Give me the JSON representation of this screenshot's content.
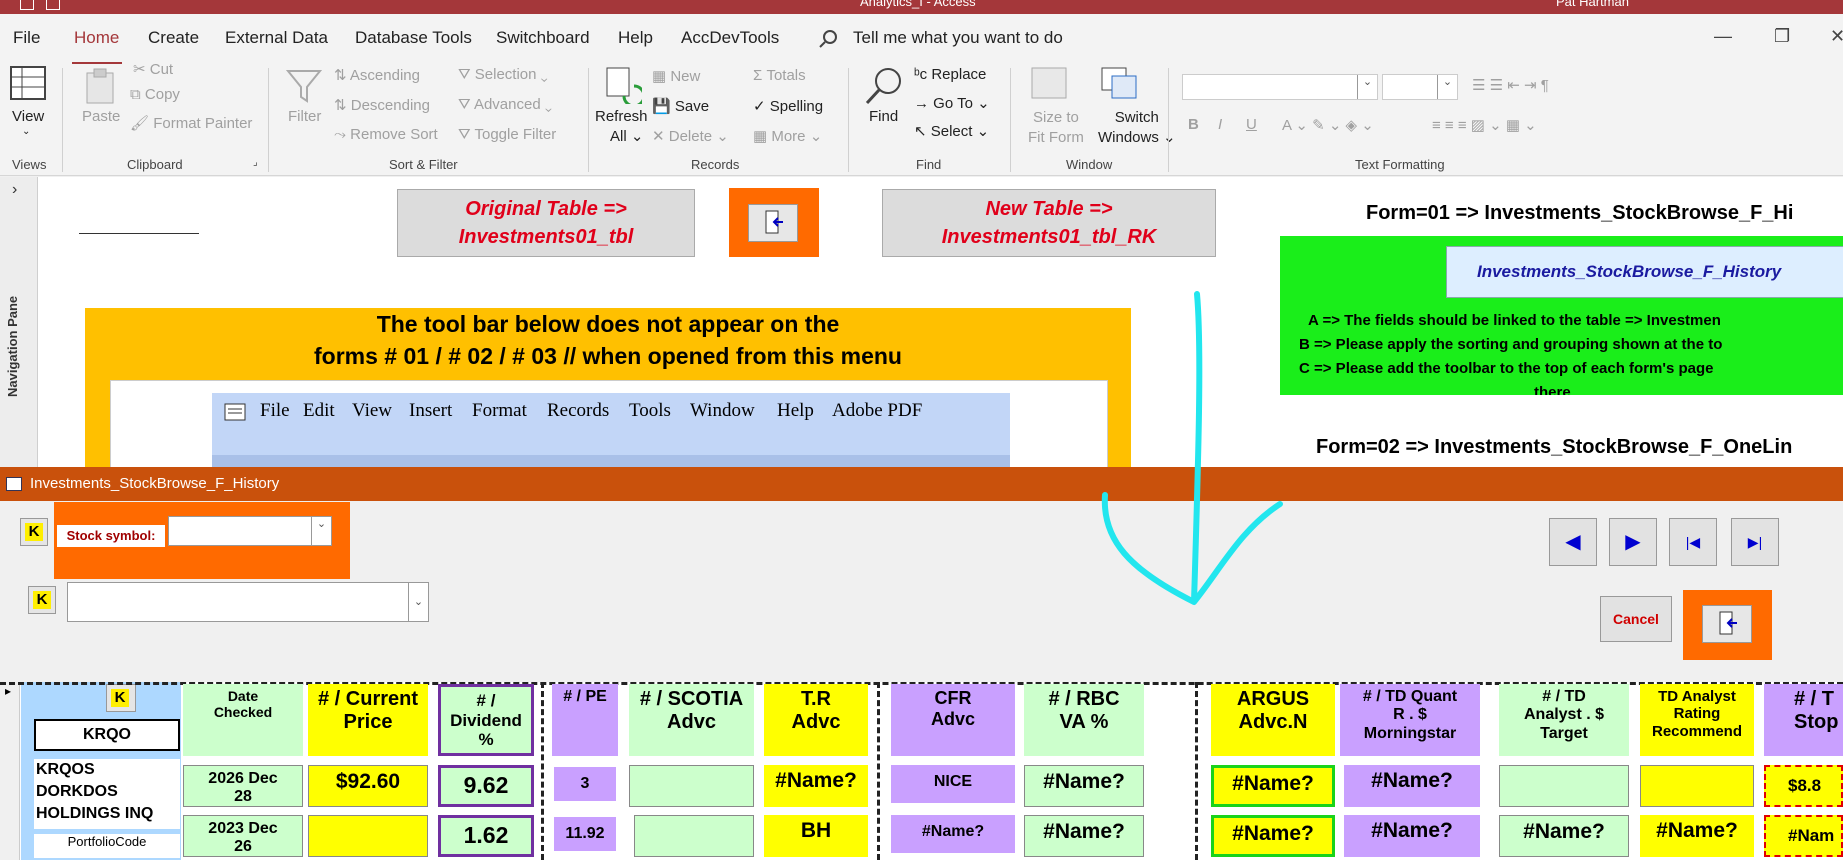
{
  "titlebar": {
    "title": "Analytics_I  -  Access",
    "user": "Pat Hartman"
  },
  "menu": {
    "tabs": [
      "File",
      "Home",
      "Create",
      "External Data",
      "Database Tools",
      "Switchboard",
      "Help",
      "AccDevTools"
    ],
    "active": "Home",
    "tell_me": "Tell me what you want to do"
  },
  "ribbon": {
    "views": {
      "view": "View",
      "group": "Views"
    },
    "clipboard": {
      "paste": "Paste",
      "cut": "Cut",
      "copy": "Copy",
      "format_painter": "Format Painter",
      "group": "Clipboard"
    },
    "sort_filter": {
      "filter": "Filter",
      "ascending": "Ascending",
      "descending": "Descending",
      "remove_sort": "Remove Sort",
      "selection": "Selection",
      "advanced": "Advanced",
      "toggle_filter": "Toggle Filter",
      "group": "Sort & Filter"
    },
    "records": {
      "refresh": "Refresh",
      "refresh_all": "All",
      "new": "New",
      "save": "Save",
      "delete": "Delete",
      "totals": "Totals",
      "spelling": "Spelling",
      "more": "More",
      "group": "Records"
    },
    "find": {
      "find": "Find",
      "replace": "Replace",
      "goto": "Go To",
      "select": "Select",
      "group": "Find"
    },
    "window": {
      "size_to": "Size to",
      "fit_form": "Fit Form",
      "switch": "Switch",
      "windows": "Windows",
      "group": "Window"
    },
    "text_formatting": {
      "group": "Text Formatting"
    }
  },
  "navpane": {
    "label": "Navigation Pane"
  },
  "workspace": {
    "orig_btn": {
      "line1": "Original Table =>",
      "line2": "Investments01_tbl"
    },
    "new_btn": {
      "line1": "New Table =>",
      "line2": "Investments01_tbl_RK"
    },
    "notice": {
      "line1": "The tool bar below does not appear on the",
      "line2": "forms # 01 / # 02 / # 03 // when opened from this menu"
    },
    "old_toolbar": [
      "File",
      "Edit",
      "View",
      "Insert",
      "Format",
      "Records",
      "Tools",
      "Window",
      "Help",
      "Adobe PDF"
    ],
    "form1": {
      "title": "Form=01 => Investments_StockBrowse_F_Hi",
      "button": "Investments_StockBrowse_F_History",
      "line_a": "A => The fields should be linked to the table => Investmen",
      "line_b": "B => Please apply the sorting and grouping shown at the to",
      "line_c": "C => Please add the toolbar to the top of each form's page",
      "line_d": "there"
    },
    "form2": {
      "title": "Form=02 => Investments_StockBrowse_F_OneLin"
    }
  },
  "form": {
    "title": "Investments_StockBrowse_F_History",
    "stock_label": "Stock symbol:",
    "k": "K",
    "cancel": "Cancel",
    "nav": {
      "prev": "◀",
      "next": "▶",
      "first": "|◀",
      "last": "▶|"
    }
  },
  "grid": {
    "symbol": "KRQO",
    "company": [
      "KRQOS",
      "DORKDOS",
      "HOLDINGS INQ"
    ],
    "portfolio_label": "PortfolioCode",
    "headers": {
      "date": [
        "Date",
        "Checked"
      ],
      "price": [
        "# / Current",
        "Price"
      ],
      "dividend": [
        "# /",
        "Dividend",
        "%"
      ],
      "pe": [
        "# / PE"
      ],
      "scotia": [
        "# / SCOTIA",
        "Advc"
      ],
      "tr": [
        "T.R",
        "Advc"
      ],
      "cfr": [
        "CFR",
        "Advc"
      ],
      "rbc": [
        "# / RBC",
        "VA %"
      ],
      "argus": [
        "ARGUS",
        "Advc.N"
      ],
      "tdquant": [
        "# / TD Quant",
        "R . $",
        "Morningstar"
      ],
      "tdanalyst": [
        "# / TD",
        "Analyst . $",
        "Target"
      ],
      "tdrating": [
        "TD Analyst",
        "Rating",
        "Recommend"
      ],
      "stop": [
        "# / T",
        "Stop"
      ]
    },
    "rows": [
      {
        "date": [
          "2026 Dec",
          "28"
        ],
        "price": "$92.60",
        "dividend": "9.62",
        "pe": "3",
        "scotia": "",
        "tr": "#Name?",
        "cfr": "NICE",
        "rbc": "#Name?",
        "argus": "#Name?",
        "tdquant": "#Name?",
        "tdanalyst": "",
        "tdrating": "",
        "stop": "$8.8"
      },
      {
        "date": [
          "2023 Dec",
          "26"
        ],
        "price": "",
        "dividend": "1.62",
        "pe": "11.92",
        "scotia": "",
        "tr": "BH",
        "cfr": "#Name?",
        "rbc": "#Name?",
        "argus": "#Name?",
        "tdquant": "#Name?",
        "tdanalyst": "#Name?",
        "tdrating": "#Name?",
        "stop": "#Nam"
      }
    ]
  },
  "annotation": {
    "color": "#22e6ee"
  }
}
